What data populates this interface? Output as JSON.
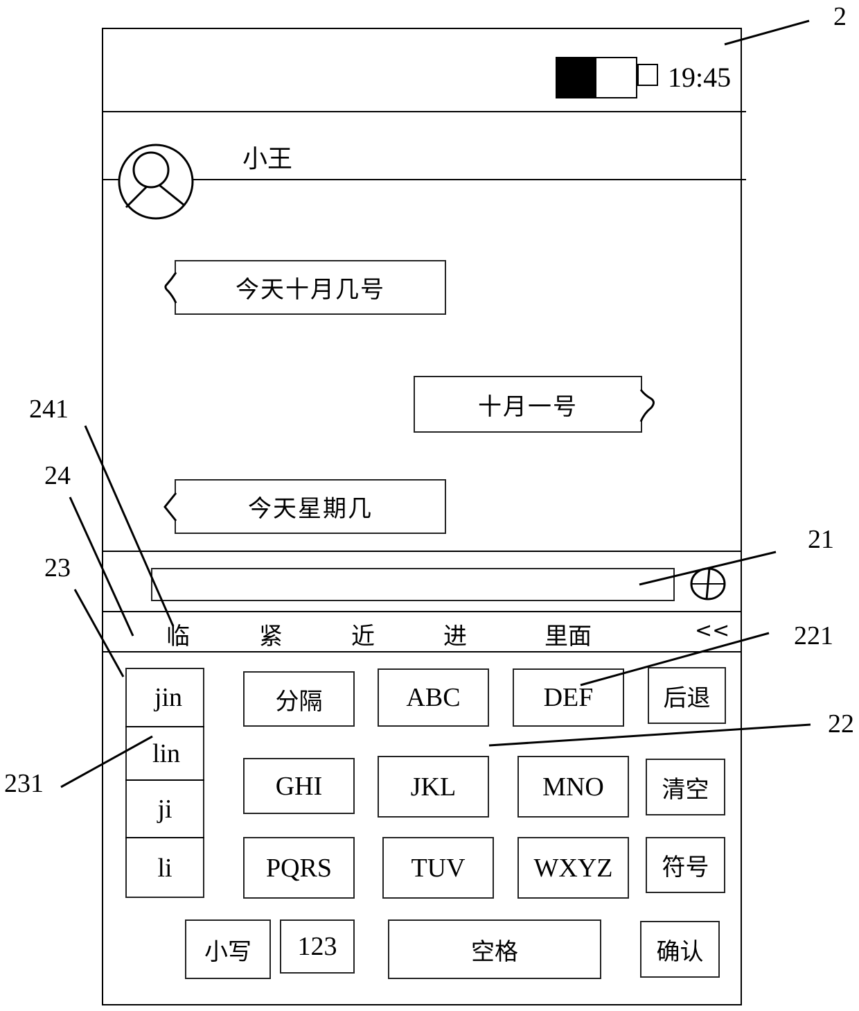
{
  "status_bar": {
    "battery_level": 0.5,
    "time": "19:45",
    "battery_icon": "battery-icon"
  },
  "chat_header": {
    "contact_name": "小王",
    "avatar_icon": "user-avatar-icon"
  },
  "messages": [
    {
      "side": "left",
      "text": "今天十月几号"
    },
    {
      "side": "right",
      "text": "十月一号"
    },
    {
      "side": "left",
      "text": "今天星期几"
    }
  ],
  "input": {
    "value": "",
    "add_icon": "circle-plus-icon"
  },
  "candidates": {
    "items": [
      "临",
      "紧",
      "近",
      "进",
      "里面"
    ],
    "collapse_label": "<<"
  },
  "pinyin_list": [
    "jin",
    "lin",
    "ji",
    "li"
  ],
  "keyboard": {
    "row1": [
      "分隔",
      "ABC",
      "DEF",
      "后退"
    ],
    "row2": [
      "GHI",
      "JKL",
      "MNO",
      "清空"
    ],
    "row3": [
      "PQRS",
      "TUV",
      "WXYZ",
      "符号"
    ],
    "row4": [
      "小写",
      "123",
      "空格",
      "确认"
    ]
  },
  "reference_labels": {
    "device": "2",
    "input_box": "21",
    "keyboard": "22",
    "key_def": "221",
    "pinyin_area": "23",
    "pinyin_item": "231",
    "candidate_bar": "24",
    "candidate_item": "241"
  }
}
